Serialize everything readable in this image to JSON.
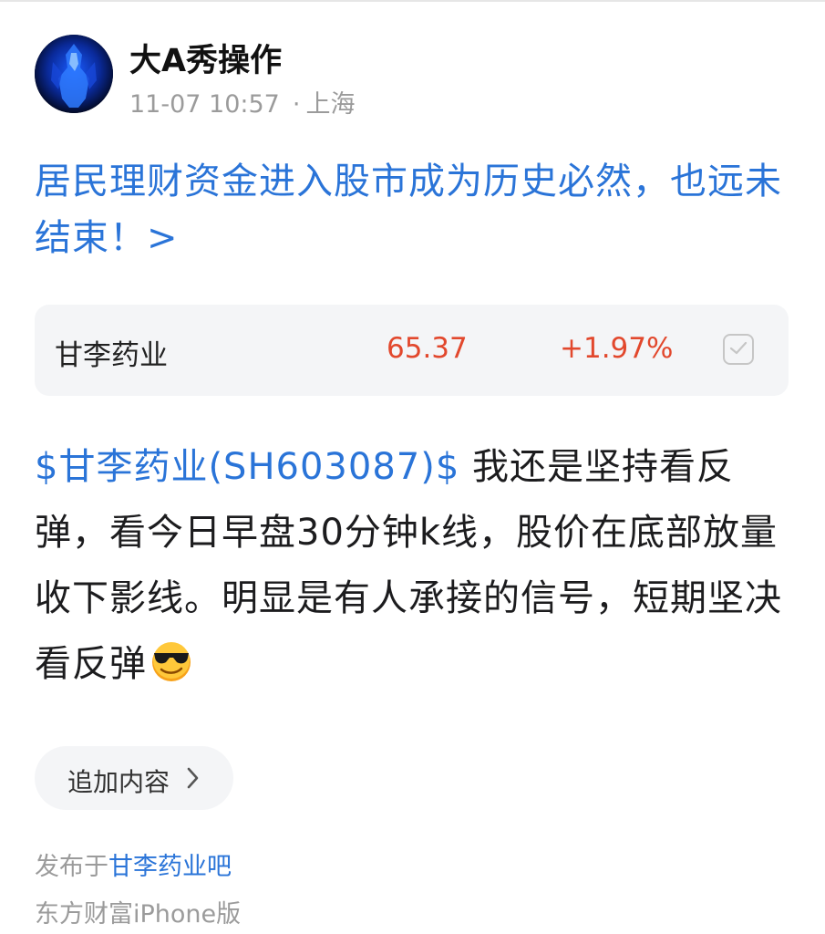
{
  "post": {
    "author": "大A秀操作",
    "time": "11-07 10:57",
    "location": "上海",
    "title": "居民理财资金进入股市成为历史必然，也远未结束！>",
    "stock_card": {
      "name": "甘李药业",
      "price": "65.37",
      "change": "+1.97%"
    },
    "body": {
      "stock_tag": "$甘李药业(SH603087)$",
      "text": " 我还是坚持看反弹，看今日早盘30分钟k线，股价在底部放量收下影线。明显是有人承接的信号，短期坚决看反弹",
      "emoji": "sunglasses-emoji"
    },
    "append_label": "追加内容",
    "published_prefix": "发布于",
    "forum": "甘李药业吧",
    "source": "东方财富iPhone版"
  },
  "colors": {
    "link_blue": "#2a74d8",
    "price_red": "#e2482d",
    "meta_gray": "#9b9b9b",
    "card_bg": "#f4f5f7"
  }
}
